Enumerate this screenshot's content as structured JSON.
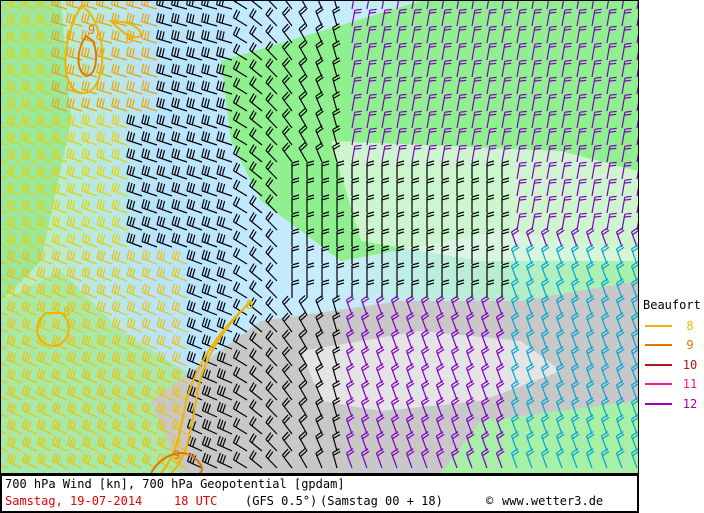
{
  "map": {
    "contour_labels": [
      {
        "text": "9",
        "color": "#e07800"
      },
      {
        "text": "8",
        "color": "#f0b400"
      },
      {
        "text": "8",
        "color": "#f0b400"
      },
      {
        "text": "8",
        "color": "#f0b400"
      },
      {
        "text": "9",
        "color": "#e07800"
      }
    ],
    "colors": {
      "sea": "#cfe8ff",
      "land_low": "#a8f0b0",
      "land_green": "#90f090",
      "mountains": "#c8c8c8"
    }
  },
  "caption": {
    "title": "700 hPa Wind [kn], 700 hPa Geopotential [gpdam]",
    "date": "Samstag, 19-07-2014",
    "time": "18 UTC",
    "model": "(GFS 0.5°)",
    "run": "(Samstag 00 + 18)",
    "copyright": "©",
    "site": "www.wetter3.de"
  },
  "legend": {
    "title": "Beaufort",
    "items": [
      {
        "label": "8",
        "color": "#f0b400"
      },
      {
        "label": "9",
        "color": "#e07800"
      },
      {
        "label": "10",
        "color": "#b01818"
      },
      {
        "label": "11",
        "color": "#ff1493"
      },
      {
        "label": "12",
        "color": "#a000b0"
      }
    ]
  }
}
